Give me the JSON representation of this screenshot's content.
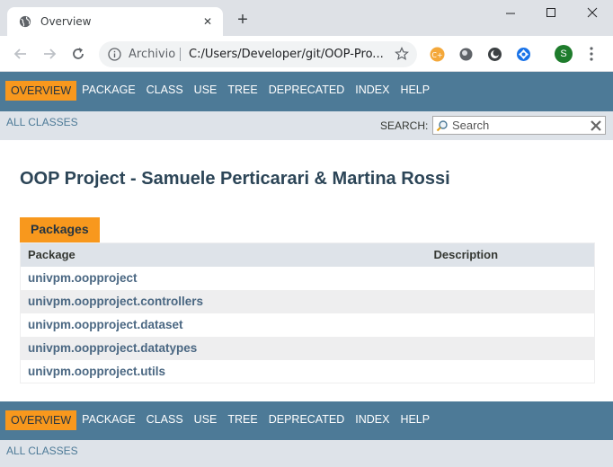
{
  "browser": {
    "tab_title": "Overview",
    "origin_label": "Archivio",
    "url": "C:/Users/Developer/git/OOP-Pro...",
    "profile_initial": "S",
    "colors": {
      "titlebar": "#dee1e6",
      "profile": "#1e7c2c"
    }
  },
  "top_nav": {
    "items": [
      "OVERVIEW",
      "PACKAGE",
      "CLASS",
      "USE",
      "TREE",
      "DEPRECATED",
      "INDEX",
      "HELP"
    ],
    "active": "OVERVIEW"
  },
  "sub_nav": {
    "all_classes": "ALL CLASSES",
    "search_label": "SEARCH:",
    "search_placeholder": "Search"
  },
  "page": {
    "title": "OOP Project - Samuele Perticarari & Martina Rossi"
  },
  "packages_table": {
    "caption": "Packages",
    "headers": [
      "Package",
      "Description"
    ],
    "rows": [
      {
        "package": "univpm.oopproject",
        "description": ""
      },
      {
        "package": "univpm.oopproject.controllers",
        "description": ""
      },
      {
        "package": "univpm.oopproject.dataset",
        "description": ""
      },
      {
        "package": "univpm.oopproject.datatypes",
        "description": ""
      },
      {
        "package": "univpm.oopproject.utils",
        "description": ""
      }
    ]
  },
  "bottom_nav": {
    "items": [
      "OVERVIEW",
      "PACKAGE",
      "CLASS",
      "USE",
      "TREE",
      "DEPRECATED",
      "INDEX",
      "HELP"
    ],
    "active": "OVERVIEW",
    "all_classes": "ALL CLASSES"
  },
  "theme": {
    "nav_bg": "#4d7a97",
    "active_bg": "#f8981d",
    "subnav_bg": "#dee3e9",
    "link": "#4a6782",
    "title": "#2c4557"
  }
}
